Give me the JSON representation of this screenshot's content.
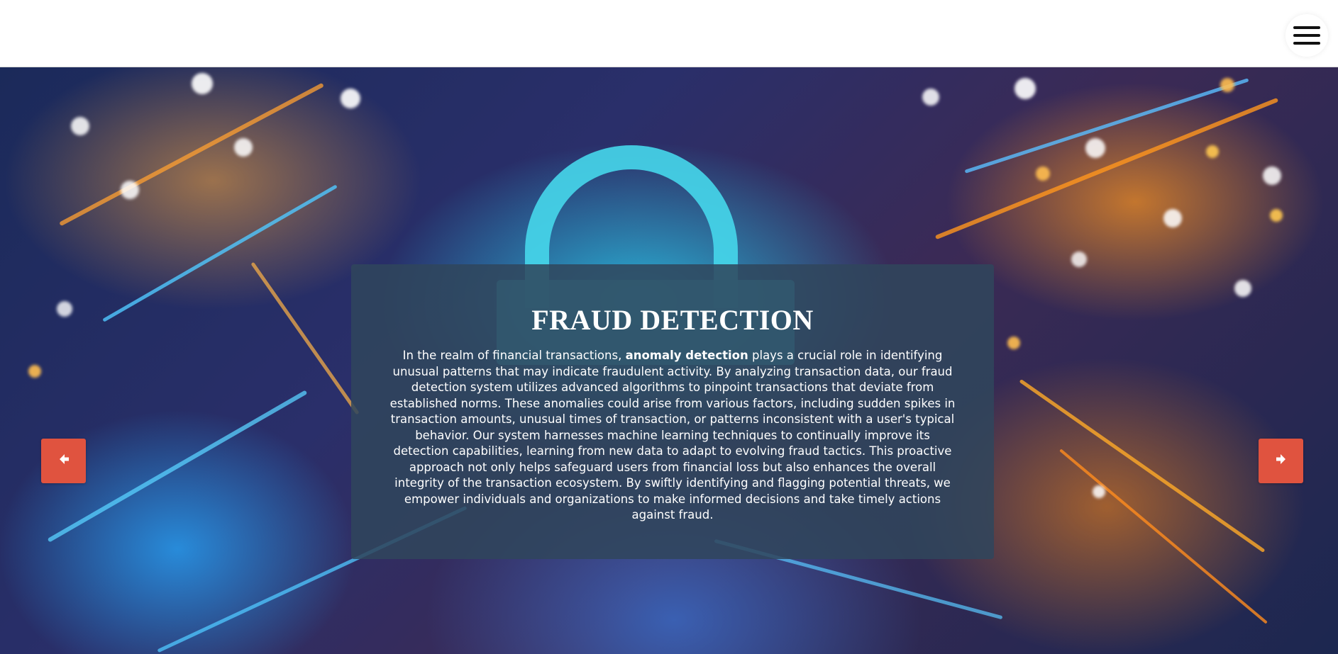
{
  "header": {
    "menu_icon": "hamburger-menu-icon"
  },
  "hero": {
    "title": "FRAUD DETECTION",
    "text_before": "In the realm of financial transactions, ",
    "text_bold": "anomaly detection",
    "text_after": " plays a crucial role in identifying unusual patterns that may indicate fraudulent activity. By analyzing transaction data, our fraud detection system utilizes advanced algorithms to pinpoint transactions that deviate from established norms. These anomalies could arise from various factors, including sudden spikes in transaction amounts, unusual times of transaction, or patterns inconsistent with a user's typical behavior. Our system harnesses machine learning techniques to continually improve its detection capabilities, learning from new data to adapt to evolving fraud tactics. This proactive approach not only helps safeguard users from financial loss but also enhances the overall integrity of the transaction ecosystem. By swiftly identifying and flagging potential threats, we empower individuals and organizations to make informed decisions and take timely actions against fraud.",
    "background_image": "circuit-board-padlock-image"
  },
  "carousel": {
    "prev_icon": "arrow-left-icon",
    "next_icon": "arrow-right-icon"
  },
  "colors": {
    "accent": "#e0533f",
    "caption_bg": "#30465c",
    "header_bg": "#ffffff"
  }
}
